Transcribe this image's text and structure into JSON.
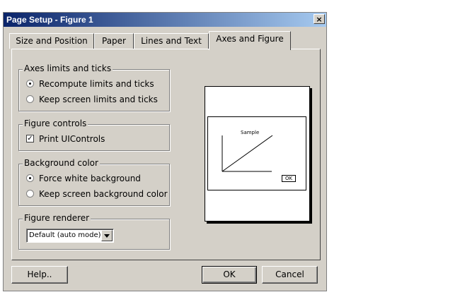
{
  "window": {
    "title": "Page Setup - Figure 1",
    "close_glyph": "×"
  },
  "tabs": [
    {
      "label": "Size and Position"
    },
    {
      "label": "Paper"
    },
    {
      "label": "Lines and Text"
    },
    {
      "label": "Axes and Figure",
      "active": true
    }
  ],
  "axes_group": {
    "legend": "Axes limits and ticks",
    "options": [
      {
        "label": "Recompute limits and ticks",
        "selected": true
      },
      {
        "label": "Keep screen limits and ticks",
        "selected": false
      }
    ]
  },
  "figure_controls_group": {
    "legend": "Figure controls",
    "checkbox": {
      "label": "Print UIControls",
      "checked": true
    }
  },
  "background_group": {
    "legend": "Background color",
    "options": [
      {
        "label": "Force white background",
        "selected": true
      },
      {
        "label": "Keep screen background color",
        "selected": false
      }
    ]
  },
  "renderer_group": {
    "legend": "Figure renderer",
    "selected_value": "Default (auto mode)"
  },
  "preview": {
    "sample_text": "Sample",
    "ok_text": "OK"
  },
  "buttons": {
    "help": "Help..",
    "ok": "OK",
    "cancel": "Cancel"
  },
  "colors": {
    "dialog_bg": "#d4d0c8",
    "titlebar_start": "#0a246a",
    "titlebar_end": "#a6caf0"
  }
}
